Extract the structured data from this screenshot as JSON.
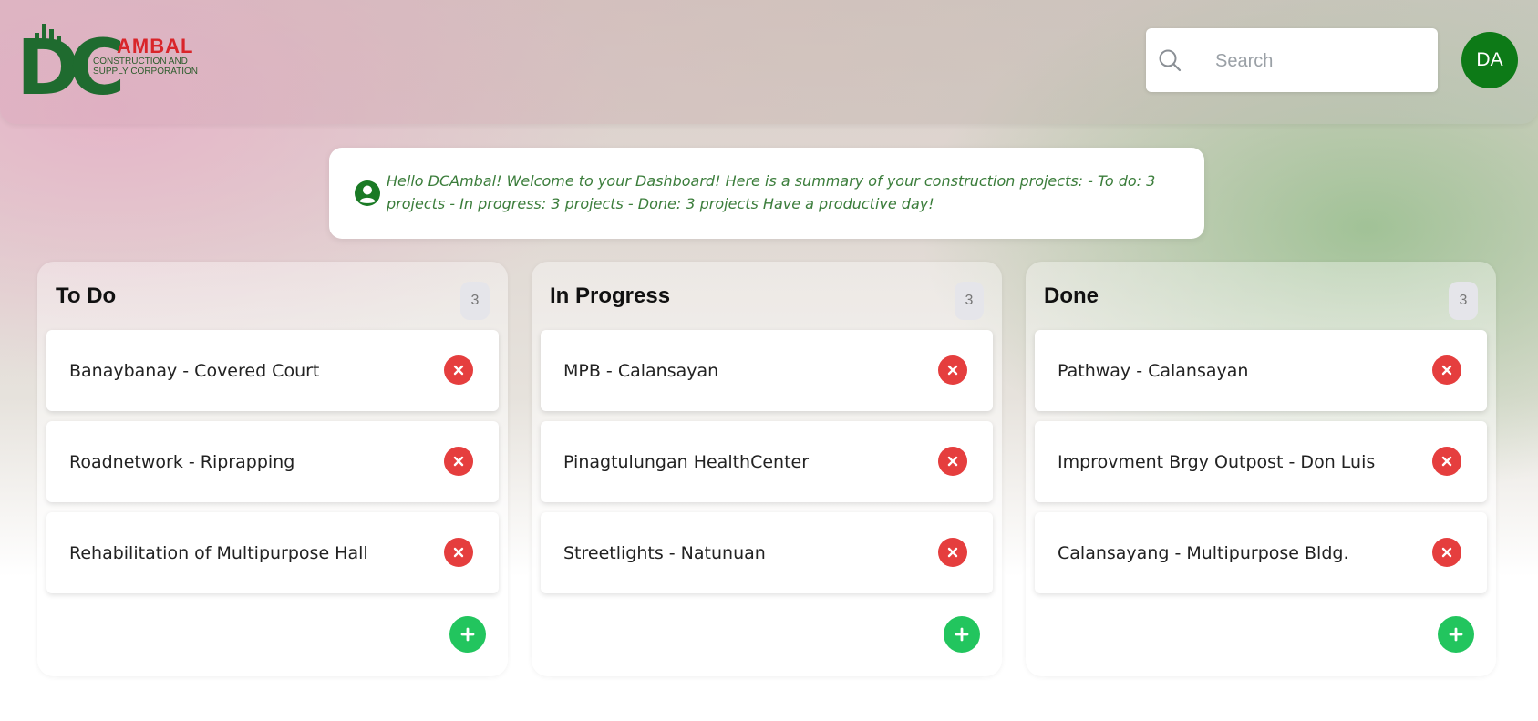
{
  "logo": {
    "mark": "DC",
    "name": "AMBAL",
    "subtitle_line1": "CONSTRUCTION AND",
    "subtitle_line2": "SUPPLY CORPORATION"
  },
  "search": {
    "placeholder": "Search",
    "value": ""
  },
  "user": {
    "initials": "DA"
  },
  "welcome": {
    "message": "Hello DCAmbal! Welcome to your Dashboard! Here is a summary of your construction projects: - To do: 3 projects - In progress: 3 projects - Done: 3 projects Have a productive day!"
  },
  "columns": [
    {
      "title": "To Do",
      "count": "3",
      "cards": [
        {
          "label": "Banaybanay - Covered Court"
        },
        {
          "label": "Roadnetwork - Riprapping"
        },
        {
          "label": "Rehabilitation of Multipurpose Hall"
        }
      ]
    },
    {
      "title": "In Progress",
      "count": "3",
      "cards": [
        {
          "label": "MPB - Calansayan"
        },
        {
          "label": "Pinagtulungan HealthCenter"
        },
        {
          "label": "Streetlights - Natunuan"
        }
      ]
    },
    {
      "title": "Done",
      "count": "3",
      "cards": [
        {
          "label": "Pathway - Calansayan"
        },
        {
          "label": "Improvment Brgy Outpost - Don Luis"
        },
        {
          "label": "Calansayang - Multipurpose Bldg."
        }
      ]
    }
  ],
  "colors": {
    "brand_green": "#1f6b2f",
    "brand_red": "#d9252a",
    "avatar_bg": "#0d7a17",
    "delete_red": "#e53e3e",
    "add_green": "#22c55e",
    "welcome_text": "#3b7d3b"
  },
  "icons": {
    "search": "search-icon",
    "user": "user-circle-icon",
    "delete": "close-icon",
    "add": "plus-icon"
  }
}
